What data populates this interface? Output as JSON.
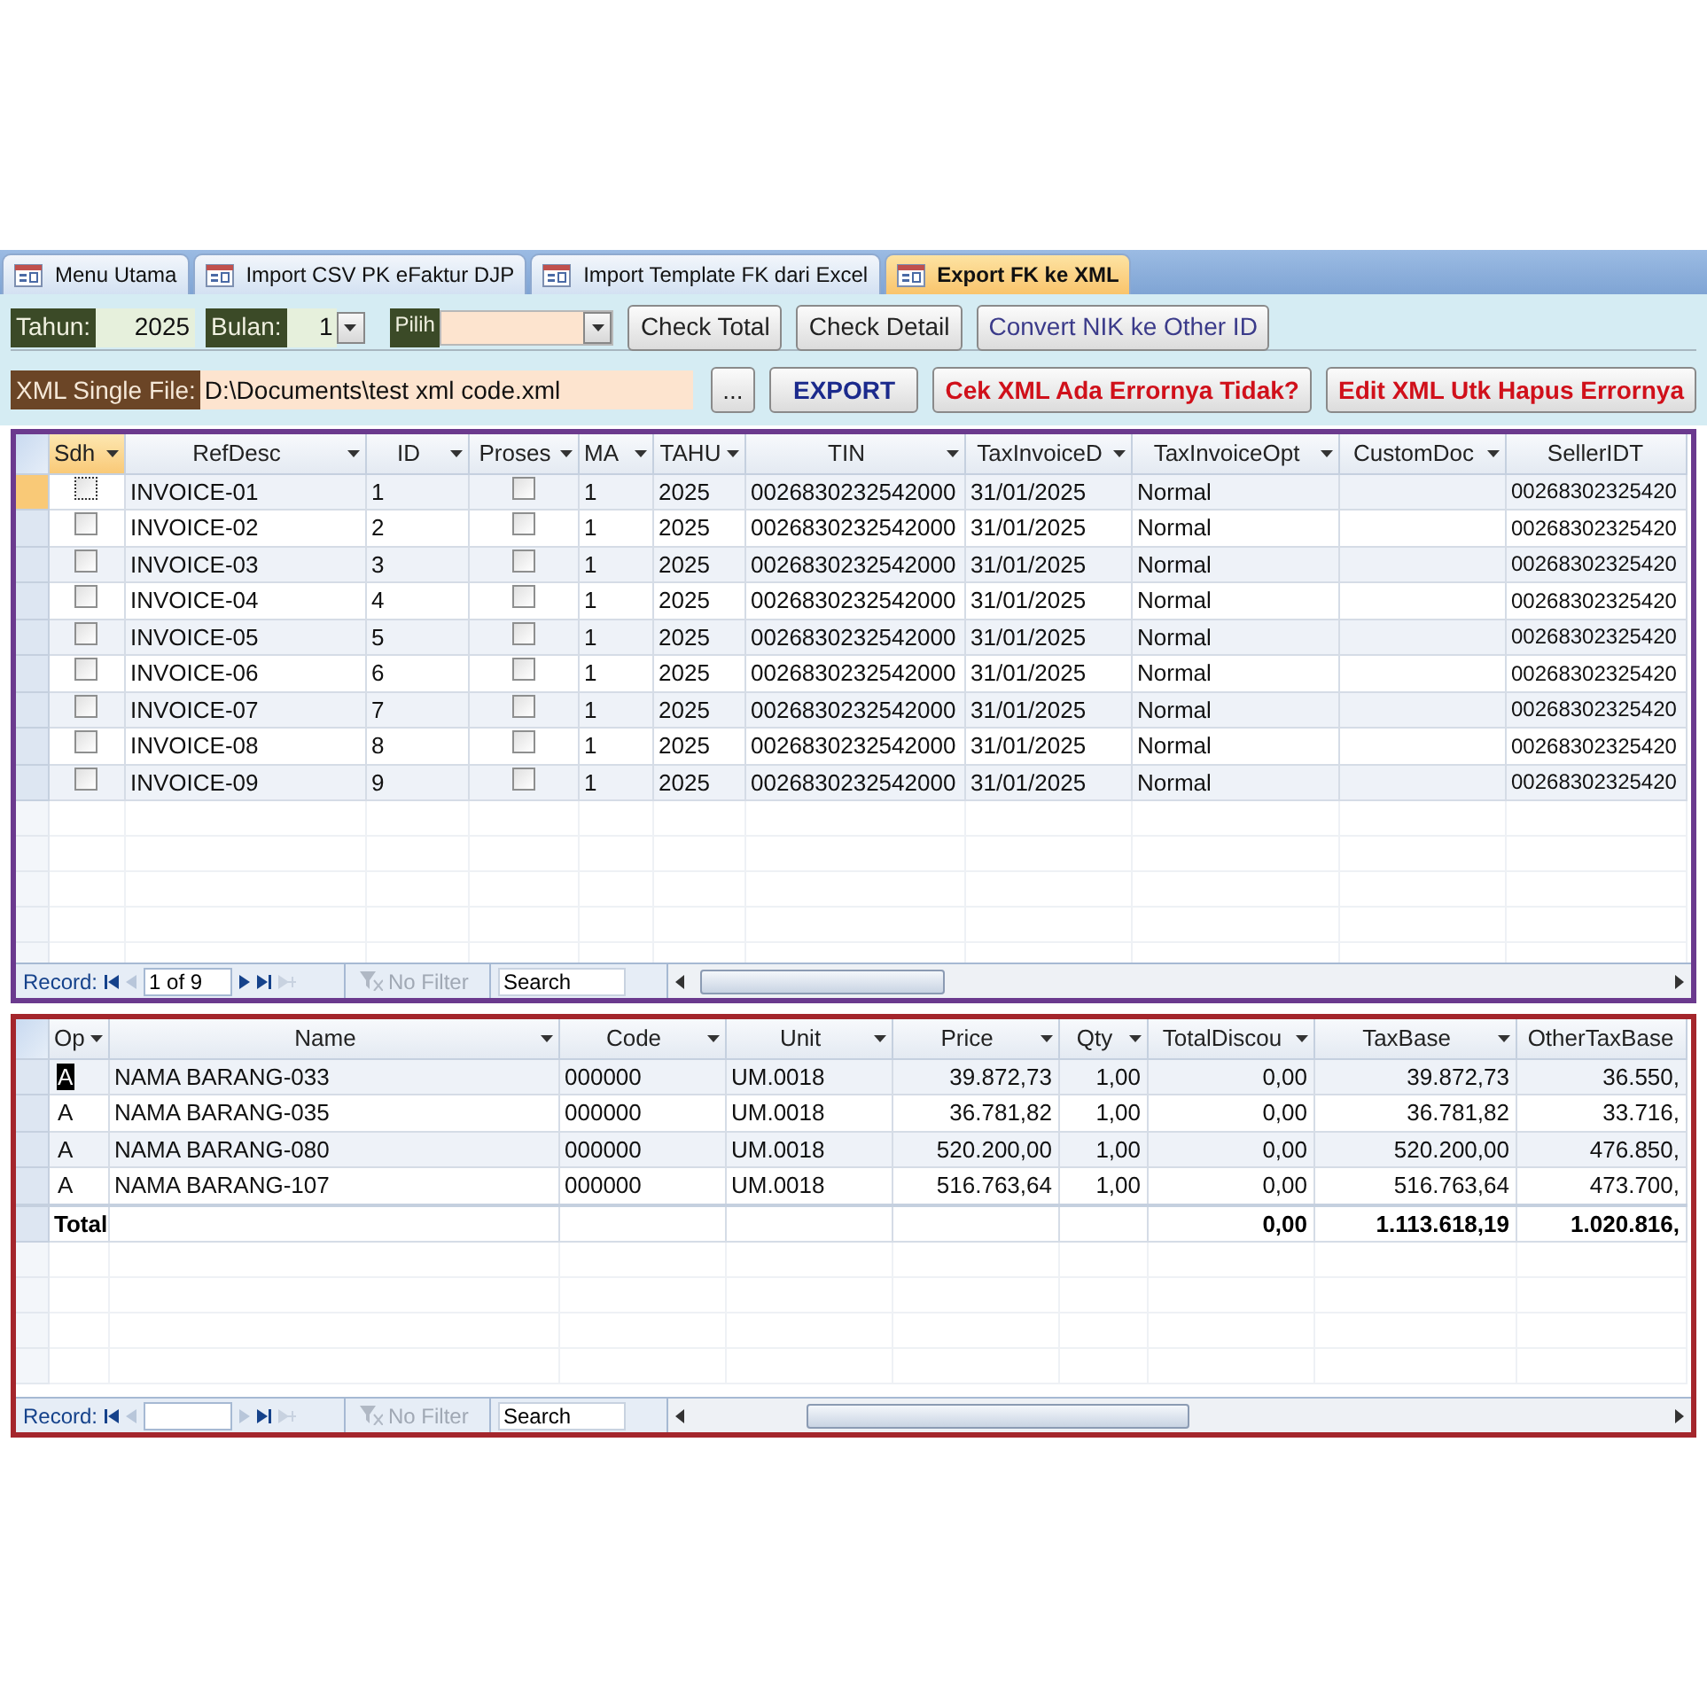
{
  "tabs": [
    {
      "label": "Menu Utama",
      "selected": false
    },
    {
      "label": "Import CSV PK eFaktur DJP",
      "selected": false
    },
    {
      "label": "Import Template FK dari Excel",
      "selected": false
    },
    {
      "label": "Export FK ke XML",
      "selected": true
    }
  ],
  "form": {
    "tahun": {
      "label": "Tahun:",
      "value": "2025"
    },
    "bulan": {
      "label": "Bulan:",
      "value": "1"
    },
    "pilih": {
      "label": "Pilih"
    },
    "top_buttons": [
      {
        "label": "Check Total",
        "kind": "normal"
      },
      {
        "label": "Check Detail",
        "kind": "normal"
      },
      {
        "label": "Convert NIK ke Other ID",
        "kind": "link"
      }
    ],
    "xml_file": {
      "label": "XML Single File:",
      "value": "D:\\Documents\\test xml code.xml"
    },
    "bottom_buttons": [
      {
        "label": "...",
        "kind": "normal"
      },
      {
        "label": "EXPORT",
        "kind": "primary"
      },
      {
        "label": "Cek XML Ada Errornya Tidak?",
        "kind": "danger"
      },
      {
        "label": "Edit XML Utk Hapus Errornya",
        "kind": "danger"
      }
    ]
  },
  "invoice_grid": {
    "columns": [
      "Sdh",
      "RefDesc",
      "ID",
      "Proses",
      "MA",
      "TAHU",
      "TIN",
      "TaxInvoiceD",
      "TaxInvoiceOpt",
      "CustomDoc",
      "SellerIDT"
    ],
    "rows": [
      {
        "selected": true,
        "cells": [
          false,
          "INVOICE-01",
          "1",
          false,
          "1",
          "2025",
          "0026830232542000",
          "31/01/2025",
          "Normal",
          null,
          "00268302325420"
        ]
      },
      {
        "selected": false,
        "cells": [
          false,
          "INVOICE-02",
          "2",
          false,
          "1",
          "2025",
          "0026830232542000",
          "31/01/2025",
          "Normal",
          null,
          "00268302325420"
        ]
      },
      {
        "selected": false,
        "cells": [
          false,
          "INVOICE-03",
          "3",
          false,
          "1",
          "2025",
          "0026830232542000",
          "31/01/2025",
          "Normal",
          null,
          "00268302325420"
        ]
      },
      {
        "selected": false,
        "cells": [
          false,
          "INVOICE-04",
          "4",
          false,
          "1",
          "2025",
          "0026830232542000",
          "31/01/2025",
          "Normal",
          null,
          "00268302325420"
        ]
      },
      {
        "selected": false,
        "cells": [
          false,
          "INVOICE-05",
          "5",
          false,
          "1",
          "2025",
          "0026830232542000",
          "31/01/2025",
          "Normal",
          null,
          "00268302325420"
        ]
      },
      {
        "selected": false,
        "cells": [
          false,
          "INVOICE-06",
          "6",
          false,
          "1",
          "2025",
          "0026830232542000",
          "31/01/2025",
          "Normal",
          null,
          "00268302325420"
        ]
      },
      {
        "selected": false,
        "cells": [
          false,
          "INVOICE-07",
          "7",
          false,
          "1",
          "2025",
          "0026830232542000",
          "31/01/2025",
          "Normal",
          null,
          "00268302325420"
        ]
      },
      {
        "selected": false,
        "cells": [
          false,
          "INVOICE-08",
          "8",
          false,
          "1",
          "2025",
          "0026830232542000",
          "31/01/2025",
          "Normal",
          null,
          "00268302325420"
        ]
      },
      {
        "selected": false,
        "cells": [
          false,
          "INVOICE-09",
          "9",
          false,
          "1",
          "2025",
          "0026830232542000",
          "31/01/2025",
          "Normal",
          null,
          "00268302325420"
        ]
      }
    ],
    "nav": {
      "label": "Record:",
      "position": "1 of 9",
      "filter": "No Filter",
      "search": "Search"
    }
  },
  "item_grid": {
    "columns": [
      "Op",
      "Name",
      "Code",
      "Unit",
      "Price",
      "Qty",
      "TotalDiscou",
      "TaxBase",
      "OtherTaxBase"
    ],
    "rows": [
      {
        "selected": true,
        "cells": [
          "A",
          "NAMA BARANG-033",
          "000000",
          "UM.0018",
          "39.872,73",
          "1,00",
          "0,00",
          "39.872,73",
          "36.550,"
        ]
      },
      {
        "selected": false,
        "cells": [
          "A",
          "NAMA BARANG-035",
          "000000",
          "UM.0018",
          "36.781,82",
          "1,00",
          "0,00",
          "36.781,82",
          "33.716,"
        ]
      },
      {
        "selected": false,
        "cells": [
          "A",
          "NAMA BARANG-080",
          "000000",
          "UM.0018",
          "520.200,00",
          "1,00",
          "0,00",
          "520.200,00",
          "476.850,"
        ]
      },
      {
        "selected": false,
        "cells": [
          "A",
          "NAMA BARANG-107",
          "000000",
          "UM.0018",
          "516.763,64",
          "1,00",
          "0,00",
          "516.763,64",
          "473.700,"
        ]
      }
    ],
    "total_row": {
      "label": "Total",
      "totals": [
        "0,00",
        "1.113.618,19",
        "1.020.816,"
      ]
    },
    "nav": {
      "label": "Record:",
      "filter": "No Filter",
      "search": "Search"
    }
  }
}
